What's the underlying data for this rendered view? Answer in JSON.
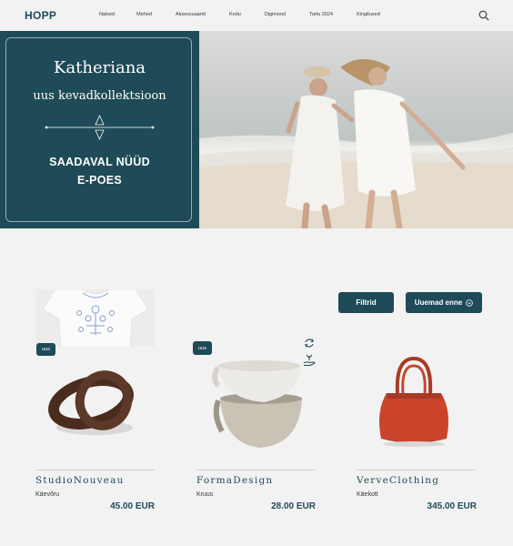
{
  "header": {
    "logo": "HOPP",
    "nav": [
      "Naised",
      "Mehed",
      "Aksessuaarid",
      "Kodu",
      "Digimood",
      "Tartu 2024",
      "Kingitused"
    ]
  },
  "hero": {
    "title": "Katheriana",
    "subtitle": "uus kevadkollektsioon",
    "cta_line1": "SAADAVAL NÜÜD",
    "cta_line2": "E-POES"
  },
  "toolbar": {
    "filter_label": "Filtrid",
    "sort_label": "Uuemad enne"
  },
  "products": [
    {
      "badge": "uus",
      "brand": "StudioNouveau",
      "name": "Käevõru",
      "price": "45.00 EUR"
    },
    {
      "badge": "uus",
      "brand": "FormaDesign",
      "name": "Kruus",
      "price": "28.00 EUR"
    },
    {
      "badge": "",
      "brand": "VerveClothing",
      "name": "Käekott",
      "price": "345.00 EUR"
    }
  ],
  "colors": {
    "brand": "#1f4a57",
    "background": "#f2f2f2"
  },
  "icons": [
    "search-icon",
    "recycle-icon",
    "hand-plant-icon",
    "chevron-circle-icon"
  ]
}
